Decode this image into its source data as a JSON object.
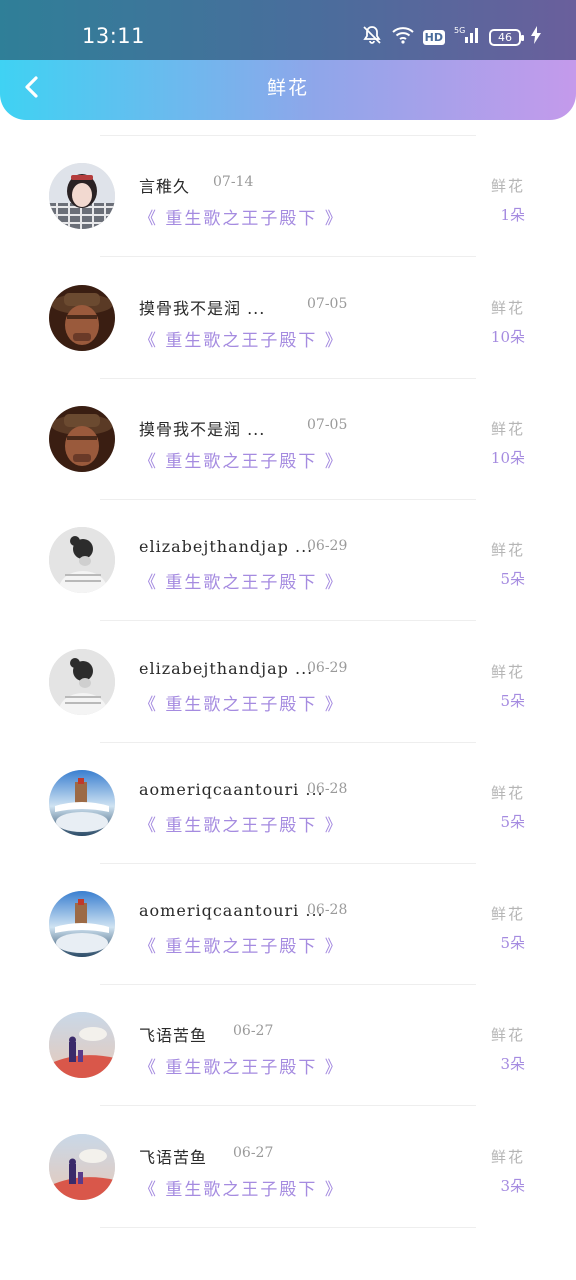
{
  "status_bar": {
    "time": "13:11",
    "battery": "46",
    "hd": "HD",
    "network": "5G"
  },
  "header": {
    "title": "鲜花",
    "back_icon": "chevron-left-icon"
  },
  "gift_label": "鲜花",
  "records": [
    {
      "user": "",
      "date": "",
      "book": "《 重生歌之王子殿下 》",
      "gift": "",
      "count": "1朵",
      "avatar": "girl-plaid"
    },
    {
      "user": "言稚久",
      "date": "07-14",
      "book": "《 重生歌之王子殿下 》",
      "gift": "鲜花",
      "count": "1朵",
      "avatar": "girl-plaid"
    },
    {
      "user": "摸骨我不是润 ...",
      "date": "07-05",
      "book": "《 重生歌之王子殿下 》",
      "gift": "鲜花",
      "count": "10朵",
      "avatar": "cowboy"
    },
    {
      "user": "摸骨我不是润 ...",
      "date": "07-05",
      "book": "《 重生歌之王子殿下 》",
      "gift": "鲜花",
      "count": "10朵",
      "avatar": "cowboy"
    },
    {
      "user": "elizabejthandjap ...",
      "date": "06-29",
      "book": "《 重生歌之王子殿下 》",
      "gift": "鲜花",
      "count": "5朵",
      "avatar": "bw-girl"
    },
    {
      "user": "elizabejthandjap ...",
      "date": "06-29",
      "book": "《 重生歌之王子殿下 》",
      "gift": "鲜花",
      "count": "5朵",
      "avatar": "bw-girl"
    },
    {
      "user": "aomeriqcaantouri ...",
      "date": "06-28",
      "book": "《 重生歌之王子殿下 》",
      "gift": "鲜花",
      "count": "5朵",
      "avatar": "globe"
    },
    {
      "user": "aomeriqcaantouri ...",
      "date": "06-28",
      "book": "《 重生歌之王子殿下 》",
      "gift": "鲜花",
      "count": "5朵",
      "avatar": "globe"
    },
    {
      "user": "飞语苦鱼",
      "date": "06-27",
      "book": "《 重生歌之王子殿下 》",
      "gift": "鲜花",
      "count": "3朵",
      "avatar": "sky"
    },
    {
      "user": "飞语苦鱼",
      "date": "06-27",
      "book": "《 重生歌之王子殿下 》",
      "gift": "鲜花",
      "count": "3朵",
      "avatar": "sky"
    }
  ],
  "colors": {
    "accent_purple": "#a58be0",
    "header_start": "#3fd2f3",
    "header_end": "#c49aeb"
  }
}
